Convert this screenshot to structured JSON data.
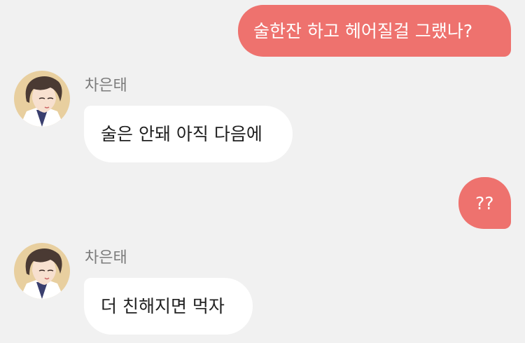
{
  "messages": [
    {
      "id": "m1",
      "side": "sent",
      "text": "술한잔 하고 헤어질걸 그랬나?"
    },
    {
      "id": "m2",
      "side": "received",
      "sender": "차은태",
      "text": "술은 안돼 아직 다음에"
    },
    {
      "id": "m3",
      "side": "sent",
      "text": "??"
    },
    {
      "id": "m4",
      "side": "received",
      "sender": "차은태",
      "text": "더 친해지면 먹자"
    }
  ],
  "colors": {
    "background": "#f1f1f1",
    "sent_bubble": "#ee726e",
    "received_bubble": "#ffffff",
    "sender_name": "#7b7b7b"
  }
}
